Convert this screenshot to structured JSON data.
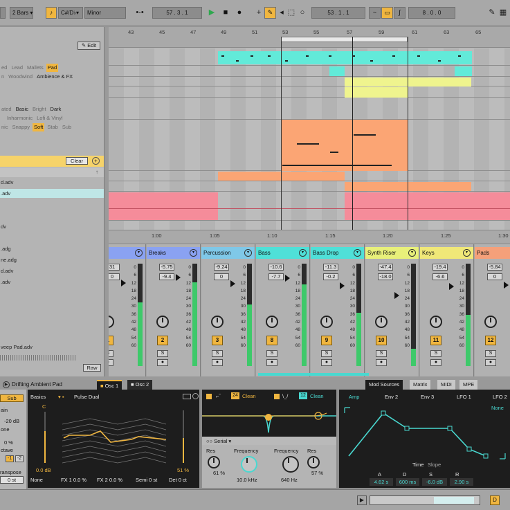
{
  "transport": {
    "loop_length": "2 Bars",
    "key": "C#/D♭",
    "scale": "Minor",
    "position": "57 . 3 . 1",
    "loop_start": "53 . 1 . 1",
    "loop_end": "8 . 0 . 0"
  },
  "browser": {
    "edit_label": "Edit",
    "tags_row1": [
      "ed",
      "Lead",
      "Mallets",
      "Pad"
    ],
    "tags_row2": [
      "n",
      "Woodwind",
      "Ambience & FX"
    ],
    "tags_row3": [
      "ated",
      "Basic",
      "Bright",
      "Dark"
    ],
    "tags_row4": [
      "",
      "Inharmonic",
      "Lofi & Vinyl"
    ],
    "tags_row5": [
      "nic",
      "Snappy",
      "Soft",
      "Stab",
      "Sub"
    ],
    "clear_label": "Clear",
    "files": [
      "d.adv",
      ".adv",
      "",
      "",
      "dv",
      "",
      "",
      ".adg",
      "ne.adg",
      "d.adv",
      ".adv",
      "",
      "",
      "",
      "",
      "veep Pad.adv"
    ],
    "raw_label": "Raw"
  },
  "arrangement": {
    "bar_numbers": [
      "43",
      "45",
      "47",
      "49",
      "51",
      "53",
      "55",
      "57",
      "59",
      "61",
      "63",
      "65"
    ],
    "time_labels": [
      "1:00",
      "1:05",
      "1:10",
      "1:15",
      "1:20",
      "1:25",
      "1:30"
    ]
  },
  "mixer": {
    "tracks": [
      {
        "name": "ms",
        "vol": "31",
        "pan": "0",
        "num": "1",
        "level": 0.62,
        "color": "#8aa2f2"
      },
      {
        "name": "Breaks",
        "vol": "-5.75",
        "pan": "-9.4",
        "num": "2",
        "level": 0.82,
        "color": "#8aa2f2"
      },
      {
        "name": "Percussion",
        "vol": "-9.24",
        "pan": "0",
        "num": "3",
        "level": 0.6,
        "color": "#7fc8e8"
      },
      {
        "name": "Bass",
        "vol": "-10.6",
        "pan": "-7.7",
        "num": "8",
        "level": 0.8,
        "color": "#4fe0d8"
      },
      {
        "name": "Bass Drop",
        "vol": "-11.3",
        "pan": "-0.2",
        "num": "9",
        "level": 0.52,
        "color": "#4fe0d8"
      },
      {
        "name": "Synth Riser",
        "vol": "-47.4",
        "pan": "-18.0",
        "num": "10",
        "level": 0.17,
        "color": "#e8f07a"
      },
      {
        "name": "Keys",
        "vol": "-19.4",
        "pan": "-6.6",
        "num": "11",
        "level": 0.5,
        "color": "#f0e878"
      },
      {
        "name": "Pads",
        "vol": "-5.84",
        "pan": "0",
        "num": "12",
        "level": 0.55,
        "color": "#f5a07a"
      }
    ],
    "ticks": [
      "0",
      "6",
      "12",
      "18",
      "24",
      "30",
      "36",
      "42",
      "48",
      "54",
      "60"
    ]
  },
  "device": {
    "title": "Drifting Ambient Pad",
    "tab_osc1": "Osc 1",
    "tab_osc2": "Osc 2",
    "right_tabs": [
      "Mod Sources",
      "Matrix",
      "MIDI",
      "MPE"
    ],
    "left_labels": {
      "sub": "Sub",
      "gain": "ain",
      "db": "-20 dB",
      "tone": "one",
      "tone_pct": "0 %",
      "octave": "ctave",
      "oct_vals": [
        "-1",
        "-2"
      ],
      "transpose": "ranspose",
      "transpose_val": "0 st"
    },
    "osc": {
      "basics": "Basics",
      "wave": "Pulse Dual",
      "c_label": "C",
      "gain_db": "0.0 dB",
      "shape_pct": "51 %",
      "none": "None",
      "fx1": "FX 1 0.0 %",
      "fx2": "FX 2 0.0 %",
      "semi": "Semi 0 st",
      "det": "Det 0 ct"
    },
    "filter": {
      "num1": "24",
      "clean1": "Clean",
      "num2": "12",
      "clean2": "Clean",
      "serial": "Serial",
      "res1": "Res",
      "res1_val": "61 %",
      "freq1": "Frequency",
      "freq1_val": "10.0 kHz",
      "freq2": "Frequency",
      "freq2_val": "640 Hz",
      "res2": "Res",
      "res2_val": "57 %"
    },
    "mod": {
      "tabs": [
        "Amp",
        "Env 2",
        "Env 3",
        "LFO 1",
        "LFO 2"
      ],
      "none": "None",
      "time": "Time",
      "slope": "Slope",
      "adsr_labels": [
        "A",
        "D",
        "S",
        "R"
      ],
      "adsr_vals": [
        "4.62 s",
        "600 ms",
        "-6.0 dB",
        "2.90 s"
      ]
    }
  },
  "colors": {
    "accent": "#f0b640",
    "cyan": "#49d8d0",
    "meter_green": "#3ec96a",
    "clip_orange": "#fba574",
    "clip_pink": "#f58c9a",
    "clip_cyan": "#62ead9",
    "clip_yellow": "#eff48e"
  }
}
